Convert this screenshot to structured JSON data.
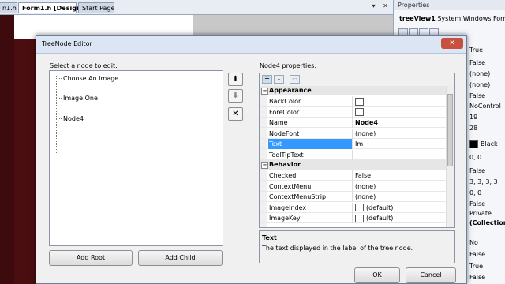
{
  "ide": {
    "tabs": [
      {
        "label": "n1.h"
      },
      {
        "label": "Form1.h [Design]*"
      },
      {
        "label": "Start Page"
      }
    ],
    "tab_controls": [
      "▾",
      "✕"
    ]
  },
  "properties_panel": {
    "title": "Properties",
    "object_name": "treeView1",
    "object_type": "System.Windows.Forms",
    "values": [
      "True",
      "False",
      "(none)",
      "(none)",
      "False",
      "NoControl",
      "19",
      "28",
      "Black",
      "0, 0",
      "False",
      "3, 3, 3, 3",
      "0, 0",
      "False",
      "Private",
      "(Collection)",
      "No",
      "False",
      "True",
      "False"
    ]
  },
  "dialog": {
    "title": "TreeNode Editor",
    "select_label": "Select a node to edit:",
    "nodes": [
      "Choose An Image",
      "Image One",
      "Node4"
    ],
    "move_up": "⬆",
    "move_down": "⬇",
    "delete": "✕",
    "add_root": "Add Root",
    "add_child": "Add Child",
    "properties_label": "Node4 properties:",
    "ok": "OK",
    "cancel": "Cancel",
    "close": "✕"
  },
  "property_grid": {
    "categories": [
      {
        "name": "Appearance",
        "rows": [
          {
            "name": "BackColor",
            "value": "",
            "swatch": true
          },
          {
            "name": "ForeColor",
            "value": "",
            "swatch": true
          },
          {
            "name": "Name",
            "value": "Node4",
            "bold": true
          },
          {
            "name": "NodeFont",
            "value": "(none)"
          },
          {
            "name": "Text",
            "value": "Im",
            "selected": true
          },
          {
            "name": "ToolTipText",
            "value": ""
          }
        ]
      },
      {
        "name": "Behavior",
        "rows": [
          {
            "name": "Checked",
            "value": "False"
          },
          {
            "name": "ContextMenu",
            "value": "(none)"
          },
          {
            "name": "ContextMenuStrip",
            "value": "(none)"
          },
          {
            "name": "ImageIndex",
            "value": "(default)",
            "swatch": true
          },
          {
            "name": "ImageKey",
            "value": "(default)",
            "swatch": true
          }
        ]
      }
    ],
    "help_title": "Text",
    "help_text": "The text displayed in the label of the tree node."
  }
}
